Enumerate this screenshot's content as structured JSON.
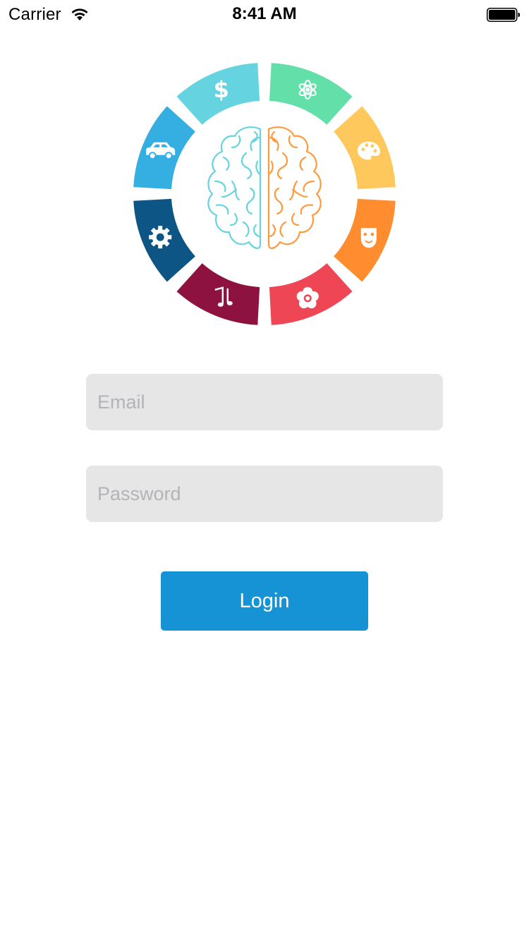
{
  "status_bar": {
    "carrier": "Carrier",
    "time": "8:41 AM",
    "wifi_icon": "wifi-icon",
    "battery_icon": "battery-icon"
  },
  "logo": {
    "description_icon": "brain-wheel-logo",
    "segments": [
      {
        "icon": "atom-icon",
        "color": "#63dfaa"
      },
      {
        "icon": "palette-icon",
        "color": "#ffc85c"
      },
      {
        "icon": "theater-mask-icon",
        "color": "#ff8d2f"
      },
      {
        "icon": "flower-icon",
        "color": "#ef4656"
      },
      {
        "icon": "music-note-icon",
        "color": "#8e1240"
      },
      {
        "icon": "gear-icon",
        "color": "#0c5585"
      },
      {
        "icon": "car-icon",
        "color": "#35aee2"
      },
      {
        "icon": "dollar-icon",
        "color": "#66d3e0"
      }
    ],
    "left_brain_color": "#66d3e0",
    "right_brain_color": "#ff9a3c"
  },
  "form": {
    "email_placeholder": "Email",
    "email_value": "",
    "password_placeholder": "Password",
    "password_value": "",
    "login_label": "Login"
  },
  "colors": {
    "field_bg": "#e6e6e6",
    "button_bg": "#1693d5",
    "button_text": "#ffffff",
    "placeholder": "#b3b3b8"
  }
}
